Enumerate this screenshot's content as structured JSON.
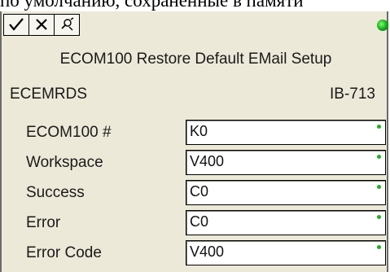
{
  "background_text": "по умолчанию, сохраненные в памяти",
  "toolbar": {
    "buttons": [
      {
        "name": "ok-check-icon"
      },
      {
        "name": "cancel-x-icon"
      },
      {
        "name": "help-icon"
      }
    ]
  },
  "status_color": "#12a61a",
  "dialog": {
    "title": "ECOM100 Restore Default EMail Setup",
    "function_name": "ECEMRDS",
    "ib_number": "IB-713",
    "fields": [
      {
        "label": "ECOM100 #",
        "value": "K0"
      },
      {
        "label": "Workspace",
        "value": "V400"
      },
      {
        "label": "Success",
        "value": "C0"
      },
      {
        "label": "Error",
        "value": "C0"
      },
      {
        "label": "Error Code",
        "value": "V400"
      }
    ]
  }
}
